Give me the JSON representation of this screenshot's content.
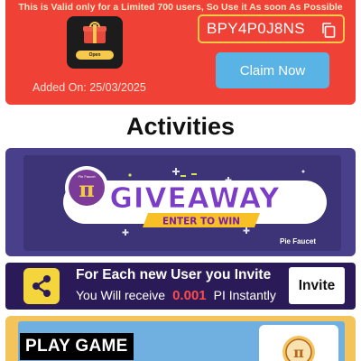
{
  "promo": {
    "note": "This is Valid only for a Limited 700 users, So Use it As soon As Possible",
    "gift_button_label": "Open",
    "added_on": "Added On: 25/03/2025",
    "code": "BPY4P0J8NS",
    "claim_label": "Claim Now"
  },
  "activities": {
    "title": "Activities"
  },
  "giveaway": {
    "pi_symbol": "π",
    "badge_text": "Pie Faucet",
    "headline": "GIVEAWAY",
    "cta": "ENTER TO WIN",
    "brand": "Pie Faucet"
  },
  "invite": {
    "title": "For Each new User you Invite",
    "receive_prefix": "You Will receive",
    "amount": "0.001",
    "receive_suffix": "PI Instantly",
    "button_label": "Invite"
  },
  "play": {
    "label": "PLAY GAME",
    "icon_symbol": "π"
  },
  "colors": {
    "promo_bg": "#ef4136",
    "claim_bg": "#59b3e4",
    "giveaway_bg": "#4a3f8a",
    "invite_bg": "#2a1b58",
    "invite_amount": "#ff4a4a",
    "play_bg": "#f4c45c"
  }
}
